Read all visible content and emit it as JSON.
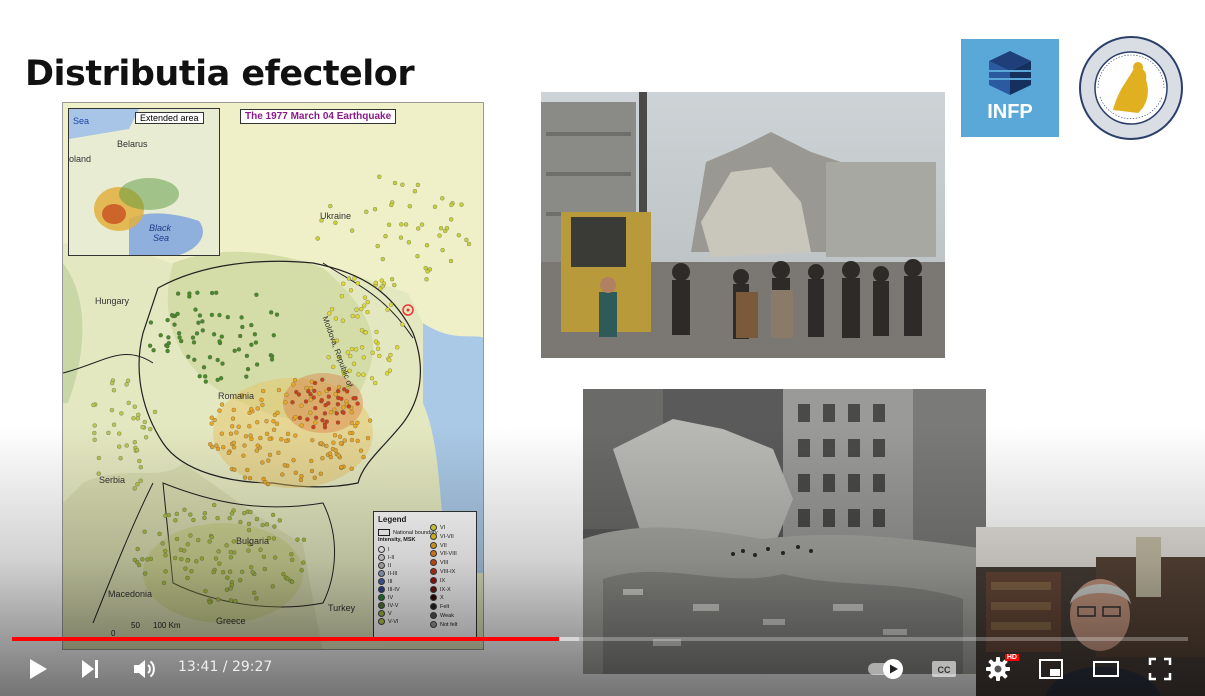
{
  "slide": {
    "title": "Distributia efectelor"
  },
  "map": {
    "title": "The 1977 March 04 Earthquake",
    "inset_title": "Extended area",
    "inset_labels": {
      "sea": "Sea",
      "belarus": "Belarus",
      "poland": "oland",
      "black_sea_1": "Black",
      "black_sea_2": "Sea"
    },
    "country_labels": {
      "ukraine": "Ukraine",
      "hungary": "Hungary",
      "romania": "Romania",
      "serbia": "Serbia",
      "bulgaria": "Bulgaria",
      "macedonia": "Macedonia",
      "greece": "Greece",
      "turkey": "Turkey",
      "moldova": "Moldova, Republic of"
    },
    "scale": {
      "zero": "0",
      "fifty": "50",
      "hundred": "100 Km"
    },
    "legend": {
      "title": "Legend",
      "national_boundary": "National boundary",
      "intensity_label": "Intensity, MSK",
      "left": [
        {
          "label": "I",
          "color": "#ffffff"
        },
        {
          "label": "I-II",
          "color": "#dddddd"
        },
        {
          "label": "II",
          "color": "#bbbbbb"
        },
        {
          "label": "II-III",
          "color": "#99aacc"
        },
        {
          "label": "III",
          "color": "#4466bb"
        },
        {
          "label": "III-IV",
          "color": "#334499"
        },
        {
          "label": "IV",
          "color": "#228833"
        },
        {
          "label": "IV-V",
          "color": "#557733"
        },
        {
          "label": "V",
          "color": "#99bb33"
        },
        {
          "label": "V-VI",
          "color": "#bbcc44"
        }
      ],
      "right": [
        {
          "label": "VI",
          "color": "#dddd33"
        },
        {
          "label": "VI-VII",
          "color": "#eecc22"
        },
        {
          "label": "VII",
          "color": "#eeaa22"
        },
        {
          "label": "VII-VIII",
          "color": "#ee8822"
        },
        {
          "label": "VIII",
          "color": "#dd5511"
        },
        {
          "label": "VIII-IX",
          "color": "#cc3311"
        },
        {
          "label": "IX",
          "color": "#aa1111"
        },
        {
          "label": "IX-X",
          "color": "#771111"
        },
        {
          "label": "X",
          "color": "#330000"
        },
        {
          "label": "Felt",
          "color": "#222222"
        },
        {
          "label": "Weak",
          "color": "#555555"
        },
        {
          "label": "Not felt",
          "color": "#999999"
        }
      ]
    }
  },
  "logos": {
    "infp_text": "INFP"
  },
  "player": {
    "time_current": "13:41",
    "time_separator": " / ",
    "time_total": "29:27",
    "progress_played_fraction": 0.465,
    "progress_buffered_fraction": 0.482,
    "hd_badge": "HD",
    "accent_color": "#ff0000",
    "icons": {
      "play": "play-icon",
      "next": "next-icon",
      "volume": "volume-icon",
      "autoplay": "autoplay-toggle-icon",
      "captions": "captions-icon",
      "settings": "settings-icon",
      "miniplayer": "miniplayer-icon",
      "theater": "theater-icon",
      "fullscreen": "fullscreen-icon"
    }
  }
}
